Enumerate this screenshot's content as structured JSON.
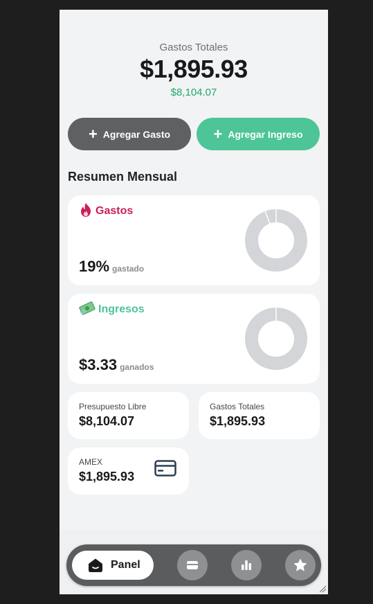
{
  "header": {
    "subtitle": "Gastos Totales",
    "total": "$1,895.93",
    "income": "$8,104.07"
  },
  "actions": {
    "add_expense": "Agregar Gasto",
    "add_income": "Agregar Ingreso"
  },
  "summary": {
    "title": "Resumen Mensual",
    "expenses": {
      "title": "Gastos",
      "icon": "fire-icon",
      "value": "19%",
      "unit": "gastado",
      "spent_fraction": 0.19,
      "color": "#c8205a"
    },
    "income": {
      "title": "Ingresos",
      "icon": "money-icon",
      "value": "$3.33",
      "unit": "ganados",
      "color": "#4dc597"
    }
  },
  "stats": {
    "free_budget_label": "Presupuesto Libre",
    "free_budget_value": "$8,104.07",
    "total_expenses_label": "Gastos Totales",
    "total_expenses_value": "$1,895.93",
    "card_label": "AMEX",
    "card_value": "$1,895.93"
  },
  "nav": {
    "active_label": "Panel",
    "items": [
      "home-icon",
      "wallet-icon",
      "bar-chart-icon",
      "star-icon"
    ]
  },
  "colors": {
    "accent_green": "#4dc597",
    "accent_red": "#c8205a",
    "income_text": "#20a86a",
    "donut_track": "#d3d5d9"
  }
}
